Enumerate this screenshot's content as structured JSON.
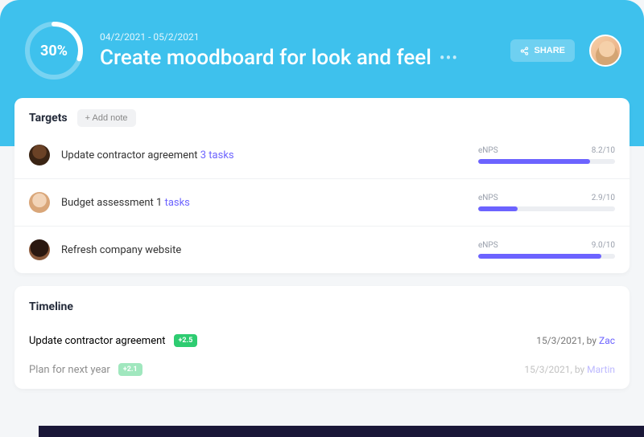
{
  "header": {
    "progress_pct": "30%",
    "progress_value": 30,
    "date_range": "04/2/2021 - 05/2/2021",
    "title": "Create moodboard for look and feel",
    "share_label": "SHARE"
  },
  "targets": {
    "title": "Targets",
    "add_note_label": "+ Add note",
    "items": [
      {
        "label": "Update contractor agreement",
        "tasks_text": "3 tasks",
        "metric_label": "eNPS",
        "score_text": "8.2/10",
        "score_pct": 82
      },
      {
        "label": "Budget assessment 1",
        "tasks_text": "tasks",
        "metric_label": "eNPS",
        "score_text": "2.9/10",
        "score_pct": 29
      },
      {
        "label": "Refresh company website",
        "tasks_text": "",
        "metric_label": "eNPS",
        "score_text": "9.0/10",
        "score_pct": 90
      }
    ]
  },
  "timeline": {
    "title": "Timeline",
    "items": [
      {
        "label": "Update contractor agreement",
        "badge": "+2.5",
        "date": "15/3/2021",
        "by_prefix": ", by ",
        "author": "Zac"
      },
      {
        "label": "Plan for next year",
        "badge": "+2.1",
        "date": "15/3/2021",
        "by_prefix": ", by ",
        "author": "Martin"
      }
    ]
  }
}
